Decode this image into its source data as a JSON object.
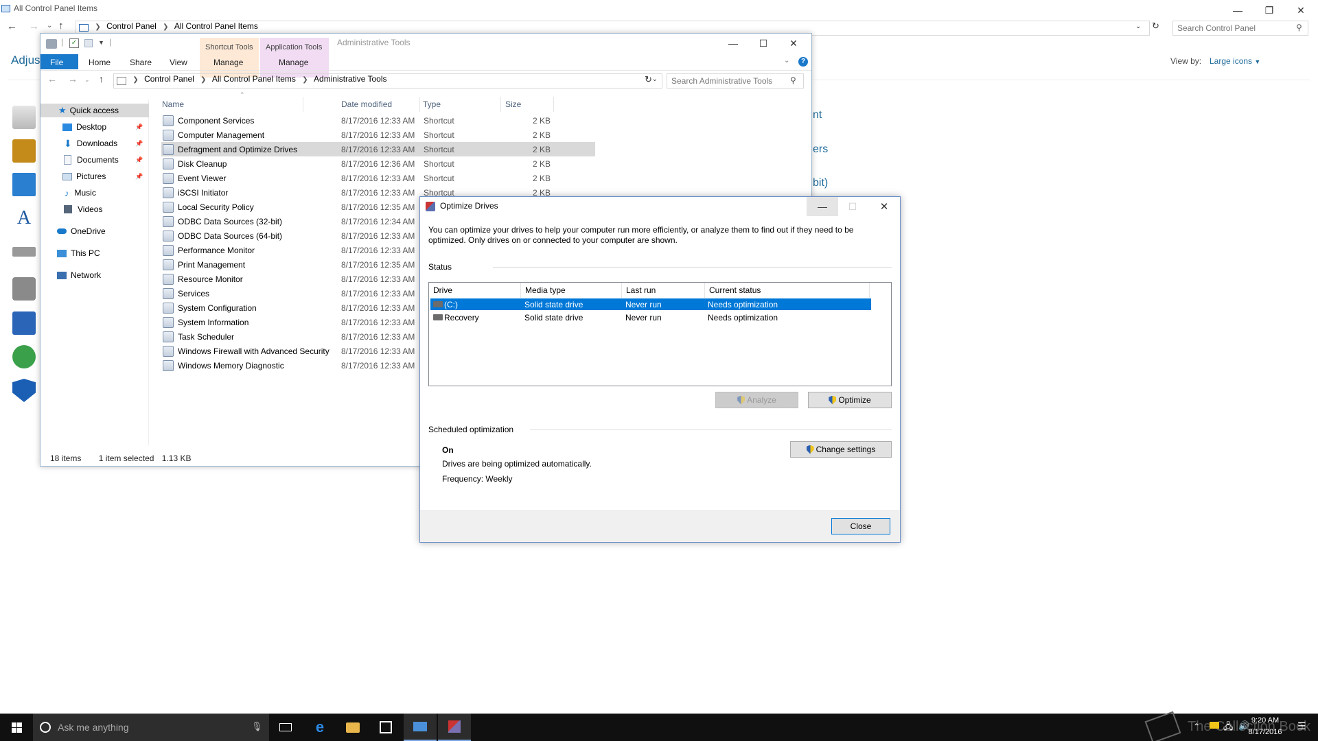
{
  "control_panel": {
    "title": "All Control Panel Items",
    "breadcrumb": [
      "Control Panel",
      "All Control Panel Items"
    ],
    "search_placeholder": "Search Control Panel",
    "heading_partial": "Adjus",
    "view_by_label": "View by:",
    "view_by_value": "Large icons",
    "partial_items": [
      "nt",
      "ers",
      "bit)"
    ]
  },
  "explorer": {
    "qat_separator": "|",
    "ribbon_tabs": [
      "File",
      "Home",
      "Share",
      "View",
      "Manage",
      "Manage"
    ],
    "context_tabs": [
      "Shortcut Tools",
      "Application Tools"
    ],
    "window_title": "Administrative Tools",
    "breadcrumb": [
      "Control Panel",
      "All Control Panel Items",
      "Administrative Tools"
    ],
    "search_placeholder": "Search Administrative Tools",
    "nav": {
      "quick_access": "Quick access",
      "pinned": [
        "Desktop",
        "Downloads",
        "Documents",
        "Pictures"
      ],
      "libraries": [
        "Music",
        "Videos"
      ],
      "onedrive": "OneDrive",
      "this_pc": "This PC",
      "network": "Network"
    },
    "columns": [
      "Name",
      "Date modified",
      "Type",
      "Size"
    ],
    "files": [
      {
        "name": "Component Services",
        "date": "8/17/2016 12:33 AM",
        "type": "Shortcut",
        "size": "2 KB"
      },
      {
        "name": "Computer Management",
        "date": "8/17/2016 12:33 AM",
        "type": "Shortcut",
        "size": "2 KB"
      },
      {
        "name": "Defragment and Optimize Drives",
        "date": "8/17/2016 12:33 AM",
        "type": "Shortcut",
        "size": "2 KB"
      },
      {
        "name": "Disk Cleanup",
        "date": "8/17/2016 12:36 AM",
        "type": "Shortcut",
        "size": "2 KB"
      },
      {
        "name": "Event Viewer",
        "date": "8/17/2016 12:33 AM",
        "type": "Shortcut",
        "size": "2 KB"
      },
      {
        "name": "iSCSI Initiator",
        "date": "8/17/2016 12:33 AM",
        "type": "Shortcut",
        "size": "2 KB"
      },
      {
        "name": "Local Security Policy",
        "date": "8/17/2016 12:35 AM",
        "type": "",
        "size": ""
      },
      {
        "name": "ODBC Data Sources (32-bit)",
        "date": "8/17/2016 12:34 AM",
        "type": "",
        "size": ""
      },
      {
        "name": "ODBC Data Sources (64-bit)",
        "date": "8/17/2016 12:33 AM",
        "type": "",
        "size": ""
      },
      {
        "name": "Performance Monitor",
        "date": "8/17/2016 12:33 AM",
        "type": "",
        "size": ""
      },
      {
        "name": "Print Management",
        "date": "8/17/2016 12:35 AM",
        "type": "",
        "size": ""
      },
      {
        "name": "Resource Monitor",
        "date": "8/17/2016 12:33 AM",
        "type": "",
        "size": ""
      },
      {
        "name": "Services",
        "date": "8/17/2016 12:33 AM",
        "type": "",
        "size": ""
      },
      {
        "name": "System Configuration",
        "date": "8/17/2016 12:33 AM",
        "type": "",
        "size": ""
      },
      {
        "name": "System Information",
        "date": "8/17/2016 12:33 AM",
        "type": "",
        "size": ""
      },
      {
        "name": "Task Scheduler",
        "date": "8/17/2016 12:33 AM",
        "type": "",
        "size": ""
      },
      {
        "name": "Windows Firewall with Advanced Security",
        "date": "8/17/2016 12:33 AM",
        "type": "",
        "size": ""
      },
      {
        "name": "Windows Memory Diagnostic",
        "date": "8/17/2016 12:33 AM",
        "type": "",
        "size": ""
      }
    ],
    "status": {
      "items": "18 items",
      "selected": "1 item selected",
      "size": "1.13 KB"
    }
  },
  "dialog": {
    "title": "Optimize Drives",
    "description": "You can optimize your drives to help your computer run more efficiently, or analyze them to find out if they need to be optimized. Only drives on or connected to your computer are shown.",
    "status_label": "Status",
    "columns": [
      "Drive",
      "Media type",
      "Last run",
      "Current status"
    ],
    "drives": [
      {
        "drive": "(C:)",
        "media": "Solid state drive",
        "last_run": "Never run",
        "status": "Needs optimization"
      },
      {
        "drive": "Recovery",
        "media": "Solid state drive",
        "last_run": "Never run",
        "status": "Needs optimization"
      }
    ],
    "analyze_label": "Analyze",
    "optimize_label": "Optimize",
    "scheduled_label": "Scheduled optimization",
    "schedule_state": "On",
    "schedule_desc": "Drives are being optimized automatically.",
    "frequency": "Frequency: Weekly",
    "change_settings_label": "Change settings",
    "close_label": "Close"
  },
  "taskbar": {
    "search_placeholder": "Ask me anything",
    "time": "9:20 AM",
    "date": "8/17/2016",
    "watermark": "The Collection Book"
  },
  "colors": {
    "selection": "#0078d7",
    "link": "#1e6a9a",
    "taskbar": "#101010"
  }
}
